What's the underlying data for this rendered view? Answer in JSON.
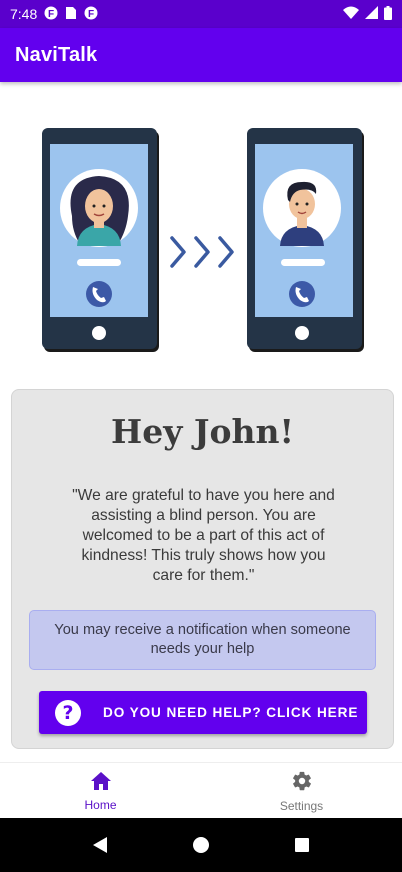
{
  "status_bar": {
    "time": "7:48",
    "left_icons": [
      "notification-f-icon",
      "sim-card-icon",
      "notification-f-icon"
    ],
    "right_icons": [
      "wifi-icon",
      "cellular-signal-icon",
      "battery-icon"
    ]
  },
  "app_bar": {
    "title": "NaviTalk"
  },
  "hero": {
    "icons": [
      "phone-woman-icon",
      "chevron-arrows-icon",
      "phone-man-icon"
    ]
  },
  "card": {
    "greeting": "Hey John!",
    "message": "\"We are grateful to have you here and assisting a blind person. You are welcomed to be a part of this act of kindness! This truly shows how you care for them.\"",
    "notice": "You may receive a notification when someone needs your help",
    "help_button": {
      "icon_glyph": "?",
      "label": "DO YOU NEED HELP? CLICK HERE"
    }
  },
  "bottom_nav": {
    "items": [
      {
        "label": "Home",
        "icon": "home-icon",
        "active": true
      },
      {
        "label": "Settings",
        "icon": "gear-icon",
        "active": false
      }
    ]
  },
  "system_nav": {
    "buttons": [
      "back-icon",
      "home-circle-icon",
      "recents-icon"
    ]
  },
  "colors": {
    "primary": "#6200ee",
    "status_bar": "#5a00cc",
    "card_bg": "#e6e6e6",
    "notice_bg": "#c4c8ef",
    "phone_screen": "#9cc4ee",
    "phone_body": "#243447",
    "arrow": "#3a5aa0"
  }
}
